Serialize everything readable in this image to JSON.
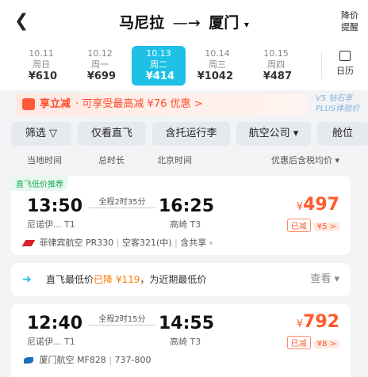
{
  "header": {
    "back_icon": "chevron-left-icon",
    "origin": "马尼拉",
    "arrow": "—→",
    "destination": "厦门",
    "alert_line1": "降价",
    "alert_line2": "提醒"
  },
  "dates": [
    {
      "date": "10.11",
      "weekday": "周日",
      "price": "¥610",
      "active": false
    },
    {
      "date": "10.12",
      "weekday": "周一",
      "price": "¥699",
      "active": false
    },
    {
      "date": "10.13",
      "weekday": "周二",
      "price": "¥414",
      "active": true
    },
    {
      "date": "10.14",
      "weekday": "周三",
      "price": "¥1042",
      "active": false
    },
    {
      "date": "10.15",
      "weekday": "周四",
      "price": "¥487",
      "active": false
    }
  ],
  "calendar_label": "日历",
  "promo": {
    "title": "享立减",
    "text": "· 可享受最高减 ¥76 优惠",
    "arrow": ">"
  },
  "vip": {
    "line1": "V5 钻石享",
    "line2": "PLUS体验价"
  },
  "filters": [
    "筛选 ▽",
    "仅看直飞",
    "含托运行李",
    "航空公司 ▾",
    "舱位"
  ],
  "columns": {
    "local_time": "当地时间",
    "duration": "总时长",
    "beijing_time": "北京时间",
    "sort": "优惠后含税均价 ▾"
  },
  "flights": [
    {
      "badge": "直飞低价推荐",
      "dep_time": "13:50",
      "arr_time": "16:25",
      "dep_airport": "尼诺伊... T1",
      "arr_airport": "高崎 T3",
      "duration": "全程2时35分",
      "currency": "¥",
      "price": "497",
      "discount_label": "已减",
      "discount_value": "¥5 >",
      "airline": "菲律宾航空 PR330",
      "aircraft": "空客321(中)",
      "codeshare": "含共享",
      "airline_color": "#d6202a"
    },
    {
      "dep_time": "12:40",
      "arr_time": "14:55",
      "dep_airport": "尼诺伊... T1",
      "arr_airport": "高崎 T3",
      "duration": "全程2时15分",
      "currency": "¥",
      "price": "792",
      "discount_label": "已减",
      "discount_value": "¥8 >",
      "airline": "厦门航空 MF828",
      "aircraft": "737-800",
      "airline_color": "#1d6fbe"
    }
  ],
  "tip": {
    "pre": "直飞最低价",
    "highlight": "已降 ¥119",
    "post": "，为近期最低价",
    "action": "查看 ▾"
  }
}
